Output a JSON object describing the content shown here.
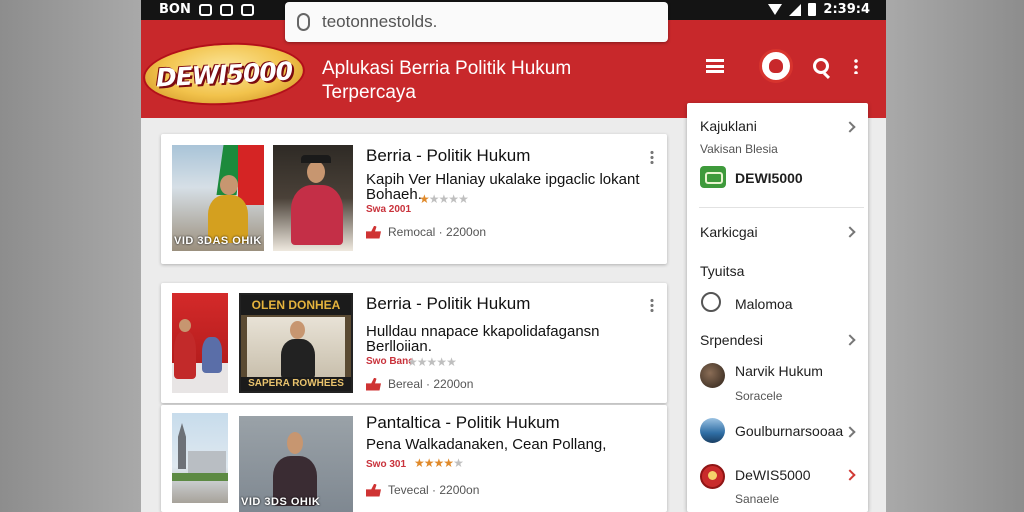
{
  "status_bar": {
    "left_text": "BON",
    "time": "2:39:4"
  },
  "browser": {
    "url": "teotonnestolds."
  },
  "header": {
    "logo_text": "DEWI5000",
    "title": "Aplukasi Berria Politik Hukum Terpercaya"
  },
  "articles": [
    {
      "title": "Berria - Politik Hukum",
      "subtitle": "Kapih Ver Hlaniay ukalake ipgaclic lokant Bohaeh.",
      "source": "Swa 2001",
      "rating": 1,
      "max_rating": 5,
      "meta": "Remocal · 2200on",
      "thumb_caption": "VID 3DAS OHIK"
    },
    {
      "title": "Berria - Politik Hukum",
      "subtitle": "Hulldau nnapace kkapolidafagansn Berlloiian.",
      "source": "Swo Bane",
      "rating": 0,
      "max_rating": 5,
      "meta": "Bereal · 2200on",
      "thumb_header": "OLEN DONHEA",
      "thumb_caption": "SAPERA ROWHEES"
    },
    {
      "title": "Pantaltica - Politik Hukum",
      "subtitle": "Pena Walkadanaken, Cean Pollang,",
      "source": "Swo 301",
      "rating": 4,
      "max_rating": 5,
      "meta": "Tevecal · 2200on",
      "thumb_caption": "VID 3DS OHIK"
    }
  ],
  "side_panel": {
    "section1": {
      "title": "Kajuklani",
      "subtitle": "Vakisan Blesia",
      "badge_label": "DEWI5000"
    },
    "section2": {
      "title": "Karkicgai"
    },
    "section3": {
      "title": "Tyuitsa",
      "item": "Malomoa"
    },
    "section4": {
      "title": "Srpendesi",
      "items": [
        {
          "label": "Narvik Hukum",
          "sub": "Soracele"
        },
        {
          "label": "Goulburnarsooaa",
          "sub": ""
        },
        {
          "label": "DeWIS5000",
          "sub": "Sanaele"
        }
      ]
    }
  },
  "colors": {
    "brand_red": "#c8282b",
    "star": "#e08a2b",
    "badge_green": "#3e9a3b"
  },
  "icons": {
    "menu": "hamburger-icon",
    "emblem": "emblem-icon",
    "search": "search-icon",
    "more": "more-vertical-icon"
  }
}
